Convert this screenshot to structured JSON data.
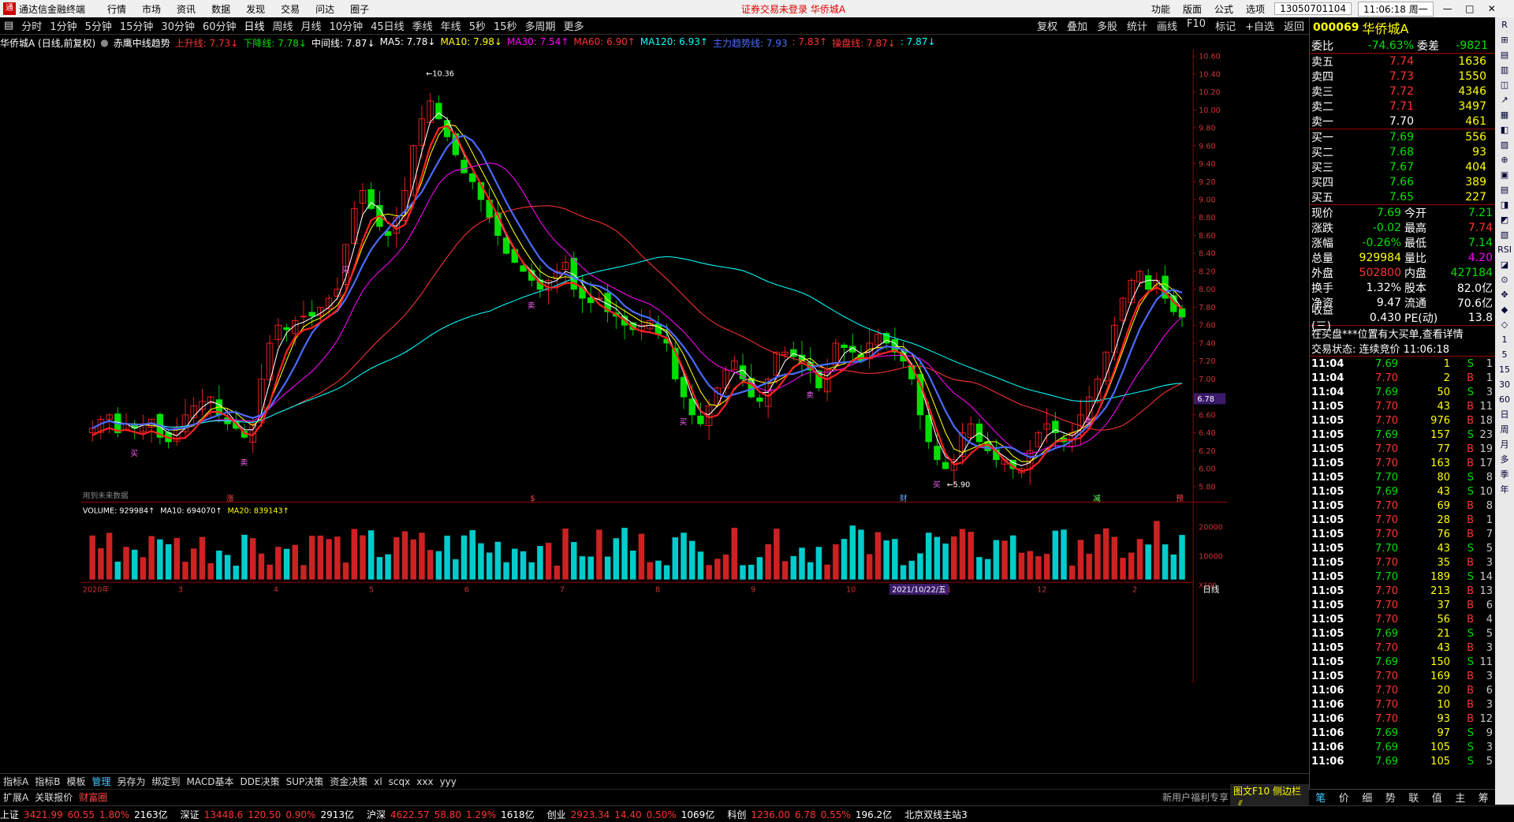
{
  "app": {
    "title": "通达信金融终端",
    "menu": [
      "行情",
      "市场",
      "资讯",
      "数据",
      "发现",
      "交易",
      "问达",
      "圈子"
    ],
    "warning": "证券交易未登录  华侨城A",
    "right_menu": [
      "功能",
      "版面",
      "公式",
      "选项"
    ],
    "account": "13050701104",
    "time": "11:06:18 周一"
  },
  "period": {
    "items": [
      "分时",
      "1分钟",
      "5分钟",
      "15分钟",
      "30分钟",
      "60分钟",
      "日线",
      "周线",
      "月线",
      "10分钟",
      "45日线",
      "季线",
      "年线",
      "5秒",
      "15秒",
      "多周期",
      "更多"
    ],
    "active": "日线",
    "tools": [
      "复权",
      "叠加",
      "多股",
      "统计",
      "画线",
      "F10",
      "标记",
      "+自选",
      "返回"
    ]
  },
  "legend": {
    "stock": "华侨城A (日线,前复权)",
    "indicator": "赤鹰中线趋势",
    "items": [
      {
        "text": "上升线: 7.73↓",
        "color": "#ff3333"
      },
      {
        "text": "下降线: 7.78↓",
        "color": "#00e000"
      },
      {
        "text": "中间线: 7.87↓",
        "color": "#ffffff"
      },
      {
        "text": "MA5: 7.78↓",
        "color": "#ffffff"
      },
      {
        "text": "MA10: 7.98↓",
        "color": "#ffff00"
      },
      {
        "text": "MA30: 7.54↑",
        "color": "#ff00ff"
      },
      {
        "text": "MA60: 6.90↑",
        "color": "#ff3333"
      },
      {
        "text": "MA120: 6.93↑",
        "color": "#00ffff"
      },
      {
        "text": "主力趋势线: 7.93",
        "color": "#4a6bff"
      },
      {
        "text": ": 7.83↑",
        "color": "#ff3333"
      },
      {
        "text": "操盘线: 7.87↓",
        "color": "#ff3333"
      },
      {
        "text": ": 7.87↓",
        "color": "#00ffff"
      }
    ]
  },
  "chart_data": {
    "type": "candlestick",
    "price_axis": {
      "labels": [
        "10.60",
        "10.40",
        "10.20",
        "10.00",
        "9.80",
        "9.60",
        "9.40",
        "9.20",
        "9.00",
        "8.80",
        "8.60",
        "8.40",
        "8.20",
        "8.00",
        "7.80",
        "7.60",
        "7.40",
        "7.20",
        "7.00",
        "6.80",
        "6.60",
        "6.40",
        "6.20",
        "6.00",
        "5.80"
      ],
      "ylim": [
        5.75,
        10.68
      ]
    },
    "annotations": {
      "high": "10.36",
      "low": "5.90",
      "current": "6.78",
      "future_data_note": "用到未来数据",
      "date_cursor": "2021/10/22/五",
      "period_label": "日线",
      "volume_scale": "X100"
    },
    "x_months": [
      "2020年",
      "3",
      "4",
      "5",
      "6",
      "7",
      "8",
      "9",
      "10",
      "11",
      "12",
      "2"
    ],
    "event_markers": [
      "涨",
      "$",
      "财",
      "减",
      "预"
    ],
    "signal_labels": [
      "买",
      "卖",
      "ψ"
    ],
    "close_path": [
      6.45,
      6.55,
      6.6,
      6.4,
      6.5,
      6.45,
      6.5,
      6.55,
      6.35,
      6.3,
      6.45,
      6.6,
      6.7,
      6.75,
      6.8,
      6.6,
      6.5,
      6.45,
      6.35,
      6.5,
      7.0,
      7.4,
      7.6,
      7.55,
      7.65,
      7.7,
      7.7,
      7.8,
      7.9,
      8.0,
      8.5,
      8.9,
      9.1,
      8.9,
      8.7,
      8.6,
      8.8,
      9.1,
      9.6,
      9.9,
      10.1,
      9.9,
      9.7,
      9.5,
      9.3,
      9.2,
      9.0,
      8.8,
      8.6,
      8.4,
      8.3,
      8.2,
      8.1,
      8.0,
      8.1,
      8.2,
      8.3,
      8.0,
      7.9,
      7.85,
      7.9,
      7.75,
      7.7,
      7.6,
      7.55,
      7.6,
      7.65,
      7.5,
      7.4,
      7.0,
      6.8,
      6.6,
      6.5,
      6.7,
      6.9,
      7.1,
      7.2,
      7.0,
      6.8,
      6.75,
      7.0,
      7.3,
      7.3,
      7.25,
      7.2,
      7.1,
      6.9,
      7.1,
      7.4,
      7.35,
      7.3,
      7.2,
      7.4,
      7.5,
      7.4,
      7.3,
      7.2,
      7.0,
      6.6,
      6.3,
      6.1,
      6.0,
      6.1,
      6.4,
      6.5,
      6.3,
      6.2,
      6.1,
      6.1,
      6.0,
      6.0,
      6.2,
      6.4,
      6.5,
      6.4,
      6.3,
      6.4,
      6.6,
      6.8,
      7.0,
      7.3,
      7.6,
      7.9,
      8.1,
      8.2,
      8.0,
      8.1,
      7.9,
      7.75,
      7.69
    ],
    "ma_series": [
      {
        "name": "MA5",
        "color": "#ffffff"
      },
      {
        "name": "MA10",
        "color": "#ffff00"
      },
      {
        "name": "MA30",
        "color": "#ff00ff"
      },
      {
        "name": "MA60",
        "color": "#ff3333"
      },
      {
        "name": "MA120",
        "color": "#00ffff"
      },
      {
        "name": "主力趋势线",
        "color": "#4a6bff"
      }
    ],
    "volume": {
      "legend": [
        {
          "text": "VOLUME: 929984↑",
          "color": "#ffffff"
        },
        {
          "text": "MA10: 694070↑",
          "color": "#ffffff"
        },
        {
          "text": "MA20: 839143↑",
          "color": "#ffff00"
        }
      ],
      "axis_labels": [
        "20000",
        "10000"
      ]
    }
  },
  "bottomtabs": {
    "items": [
      "指标A",
      "指标B",
      "模板",
      "管理",
      "另存为",
      "绑定到",
      "MACD基本",
      "DDE决策",
      "SUP决策",
      "资金决策",
      "xl",
      "scqx",
      "xxx",
      "yyy"
    ],
    "active": "管理"
  },
  "bottomtabs2": {
    "items": [
      "扩展A",
      "关联报价",
      "财富圈"
    ],
    "ticker": "新用户福利专享",
    "yellowtab": "图文F10 侧边栏《"
  },
  "status": [
    {
      "label": "上证",
      "value": "3421.99",
      "chg": "60.55",
      "pct": "1.80%",
      "amt": "2163亿"
    },
    {
      "label": "深证",
      "value": "13448.6",
      "chg": "120.50",
      "pct": "0.90%",
      "amt": "2913亿"
    },
    {
      "label": "沪深",
      "value": "4622.57",
      "chg": "58.80",
      "pct": "1.29%",
      "amt": "1618亿"
    },
    {
      "label": "创业",
      "value": "2923.34",
      "chg": "14.40",
      "pct": "0.50%",
      "amt": "1069亿"
    },
    {
      "label": "科创",
      "value": "1236.00",
      "chg": "6.78",
      "pct": "0.55%",
      "amt": "196.2亿"
    }
  ],
  "status_extra": "北京双线主站3",
  "quote": {
    "code": "000069",
    "name": "华侨城A",
    "weibi": {
      "label": "委比",
      "value": "-74.63%",
      "label2": "委差",
      "value2": "-9821"
    },
    "sell": [
      {
        "label": "卖五",
        "price": "7.74",
        "vol": "1636"
      },
      {
        "label": "卖四",
        "price": "7.73",
        "vol": "1550"
      },
      {
        "label": "卖三",
        "price": "7.72",
        "vol": "4346"
      },
      {
        "label": "卖二",
        "price": "7.71",
        "vol": "3497"
      },
      {
        "label": "卖一",
        "price": "7.70",
        "vol": "461"
      }
    ],
    "buy": [
      {
        "label": "买一",
        "price": "7.69",
        "vol": "556"
      },
      {
        "label": "买二",
        "price": "7.68",
        "vol": "93"
      },
      {
        "label": "买三",
        "price": "7.67",
        "vol": "404"
      },
      {
        "label": "买四",
        "price": "7.66",
        "vol": "389"
      },
      {
        "label": "买五",
        "price": "7.65",
        "vol": "227"
      }
    ],
    "stats": [
      {
        "l1": "现价",
        "v1": "7.69",
        "c1": "green",
        "l2": "今开",
        "v2": "7.21",
        "c2": "green"
      },
      {
        "l1": "涨跌",
        "v1": "-0.02",
        "c1": "green",
        "l2": "最高",
        "v2": "7.74",
        "c2": "red"
      },
      {
        "l1": "涨幅",
        "v1": "-0.26%",
        "c1": "green",
        "l2": "最低",
        "v2": "7.14",
        "c2": "green"
      },
      {
        "l1": "总量",
        "v1": "929984",
        "c1": "yellow",
        "l2": "量比",
        "v2": "4.20",
        "c2": "magenta"
      },
      {
        "l1": "外盘",
        "v1": "502800",
        "c1": "red",
        "l2": "内盘",
        "v2": "427184",
        "c2": "green"
      },
      {
        "l1": "换手",
        "v1": "1.32%",
        "c1": "white",
        "l2": "股本",
        "v2": "82.0亿",
        "c2": "white"
      },
      {
        "l1": "净资",
        "v1": "9.47",
        "c1": "white",
        "l2": "流通",
        "v2": "70.6亿",
        "c2": "white"
      },
      {
        "l1": "收益(三)",
        "v1": "0.430",
        "c1": "white",
        "l2": "PE(动)",
        "v2": "13.8",
        "c2": "white"
      }
    ],
    "notice": "在买盘***位置有大买单,查看详情",
    "trade_state": "交易状态: 连续竞价 11:06:18",
    "ticks": [
      [
        "11:04",
        "7.69",
        "1",
        "S",
        "1"
      ],
      [
        "11:04",
        "7.70",
        "2",
        "B",
        "1"
      ],
      [
        "11:04",
        "7.69",
        "50",
        "S",
        "3"
      ],
      [
        "11:05",
        "7.70",
        "43",
        "B",
        "11"
      ],
      [
        "11:05",
        "7.70",
        "976",
        "B",
        "18"
      ],
      [
        "11:05",
        "7.69",
        "157",
        "S",
        "23"
      ],
      [
        "11:05",
        "7.70",
        "77",
        "B",
        "19"
      ],
      [
        "11:05",
        "7.70",
        "163",
        "B",
        "17"
      ],
      [
        "11:05",
        "7.70",
        "80",
        "S",
        "8"
      ],
      [
        "11:05",
        "7.69",
        "43",
        "S",
        "10"
      ],
      [
        "11:05",
        "7.70",
        "69",
        "B",
        "8"
      ],
      [
        "11:05",
        "7.70",
        "28",
        "B",
        "1"
      ],
      [
        "11:05",
        "7.70",
        "76",
        "B",
        "7"
      ],
      [
        "11:05",
        "7.70",
        "43",
        "S",
        "5"
      ],
      [
        "11:05",
        "7.70",
        "35",
        "B",
        "3"
      ],
      [
        "11:05",
        "7.70",
        "189",
        "S",
        "14"
      ],
      [
        "11:05",
        "7.70",
        "213",
        "B",
        "13"
      ],
      [
        "11:05",
        "7.70",
        "37",
        "B",
        "6"
      ],
      [
        "11:05",
        "7.70",
        "56",
        "B",
        "4"
      ],
      [
        "11:05",
        "7.69",
        "21",
        "S",
        "5"
      ],
      [
        "11:05",
        "7.70",
        "43",
        "B",
        "3"
      ],
      [
        "11:05",
        "7.69",
        "150",
        "S",
        "11"
      ],
      [
        "11:05",
        "7.70",
        "169",
        "B",
        "3"
      ],
      [
        "11:06",
        "7.70",
        "20",
        "B",
        "6"
      ],
      [
        "11:06",
        "7.70",
        "10",
        "B",
        "3"
      ],
      [
        "11:06",
        "7.70",
        "93",
        "B",
        "12"
      ],
      [
        "11:06",
        "7.69",
        "97",
        "S",
        "9"
      ],
      [
        "11:06",
        "7.69",
        "105",
        "S",
        "3"
      ],
      [
        "11:06",
        "7.69",
        "105",
        "S",
        "5"
      ]
    ],
    "tabs": [
      "笔",
      "价",
      "细",
      "势",
      "联",
      "值",
      "主",
      "筹"
    ],
    "active_tab": "笔"
  },
  "sidebar": [
    "R",
    "⊞",
    "▤",
    "▥",
    "◫",
    "↗",
    "▦",
    "◧",
    "▨",
    "⊕",
    "▣",
    "▤",
    "◨",
    "◩",
    "▧",
    "RSI",
    "◪",
    "⊙",
    "✥",
    "◆",
    "◇",
    "1",
    "5",
    "15",
    "30",
    "60",
    "日",
    "周",
    "月",
    "多",
    "季",
    "年"
  ]
}
